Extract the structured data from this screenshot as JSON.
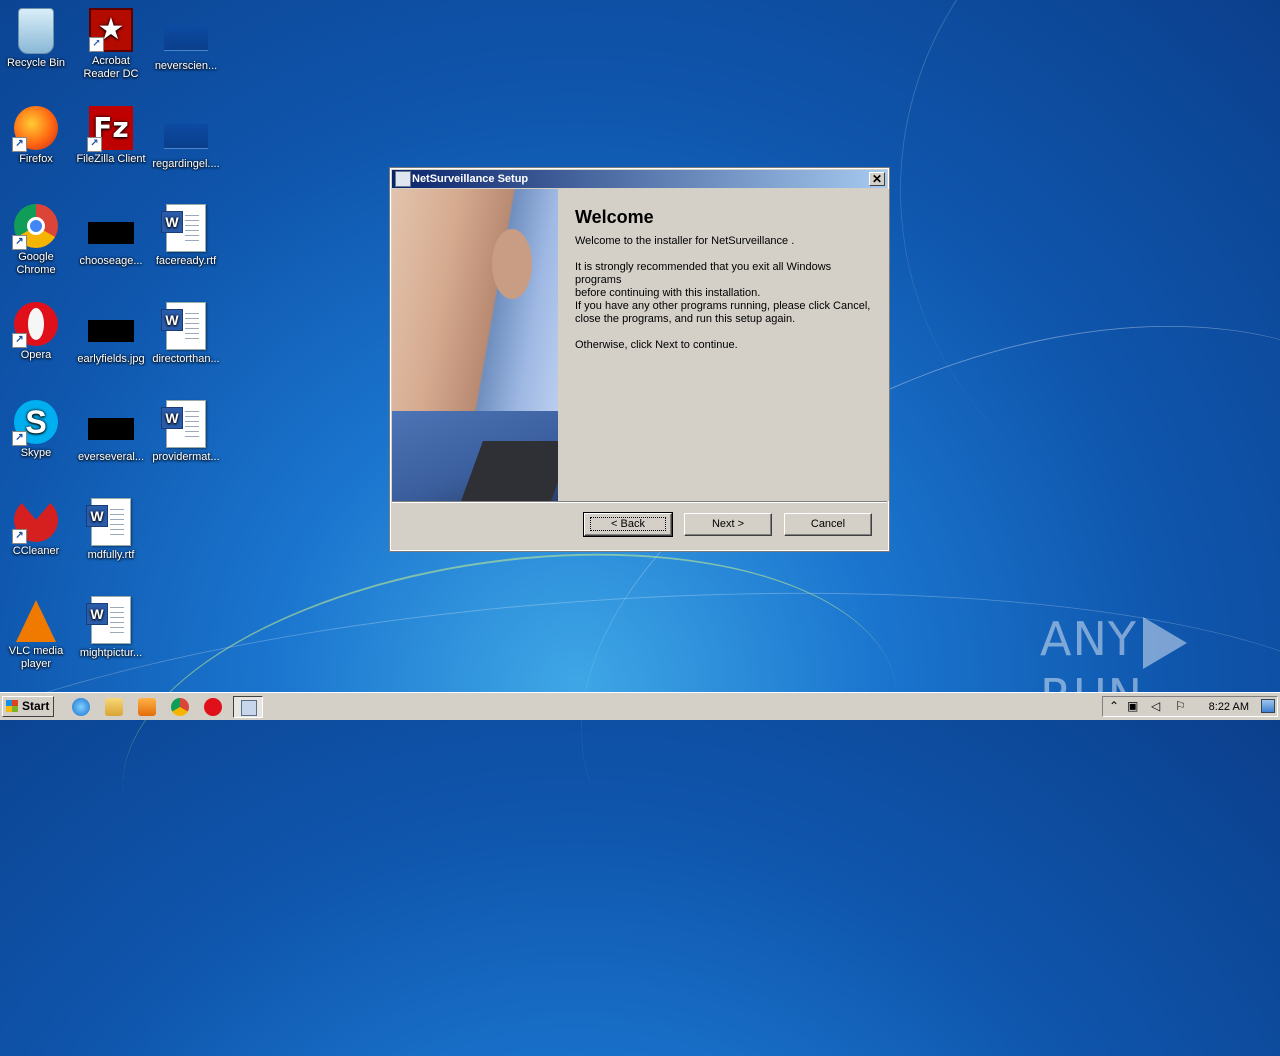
{
  "desktop": {
    "icons": [
      {
        "label": "Recycle Bin"
      },
      {
        "label": "Acrobat Reader DC"
      },
      {
        "label": "neverscien..."
      },
      {
        "label": "Firefox"
      },
      {
        "label": "FileZilla Client"
      },
      {
        "label": "regardingel...."
      },
      {
        "label": "Google Chrome"
      },
      {
        "label": "chooseage..."
      },
      {
        "label": "faceready.rtf"
      },
      {
        "label": "Opera"
      },
      {
        "label": "earlyfields.jpg"
      },
      {
        "label": "directorthan..."
      },
      {
        "label": "Skype"
      },
      {
        "label": "everseveral..."
      },
      {
        "label": "providermat..."
      },
      {
        "label": "CCleaner"
      },
      {
        "label": "mdfully.rtf"
      },
      {
        "label": "VLC media player"
      },
      {
        "label": "mightpictur..."
      }
    ]
  },
  "dialog": {
    "title": "NetSurveillance Setup",
    "close_glyph": "✕",
    "heading": "Welcome",
    "paragraphs": [
      "Welcome to the installer for NetSurveillance .",
      "It is strongly recommended that you exit all Windows programs\nbefore continuing with this installation.",
      "If you have any other programs running, please click Cancel,\nclose the programs, and run this setup again.",
      "Otherwise, click Next to continue."
    ],
    "buttons": {
      "back": "< Back",
      "next": "Next >",
      "cancel": "Cancel"
    }
  },
  "watermark": {
    "left": "ANY",
    "right": "RUN"
  },
  "taskbar": {
    "start_label": "Start",
    "clock": "8:22 AM",
    "tray_icons": [
      "show-hidden-icon",
      "action-center-icon",
      "volume-icon",
      "flag-icon"
    ],
    "tray_glyphs": {
      "show_hidden": "⌃",
      "network": "▣",
      "volume": "◁",
      "flag": "⚐"
    }
  }
}
